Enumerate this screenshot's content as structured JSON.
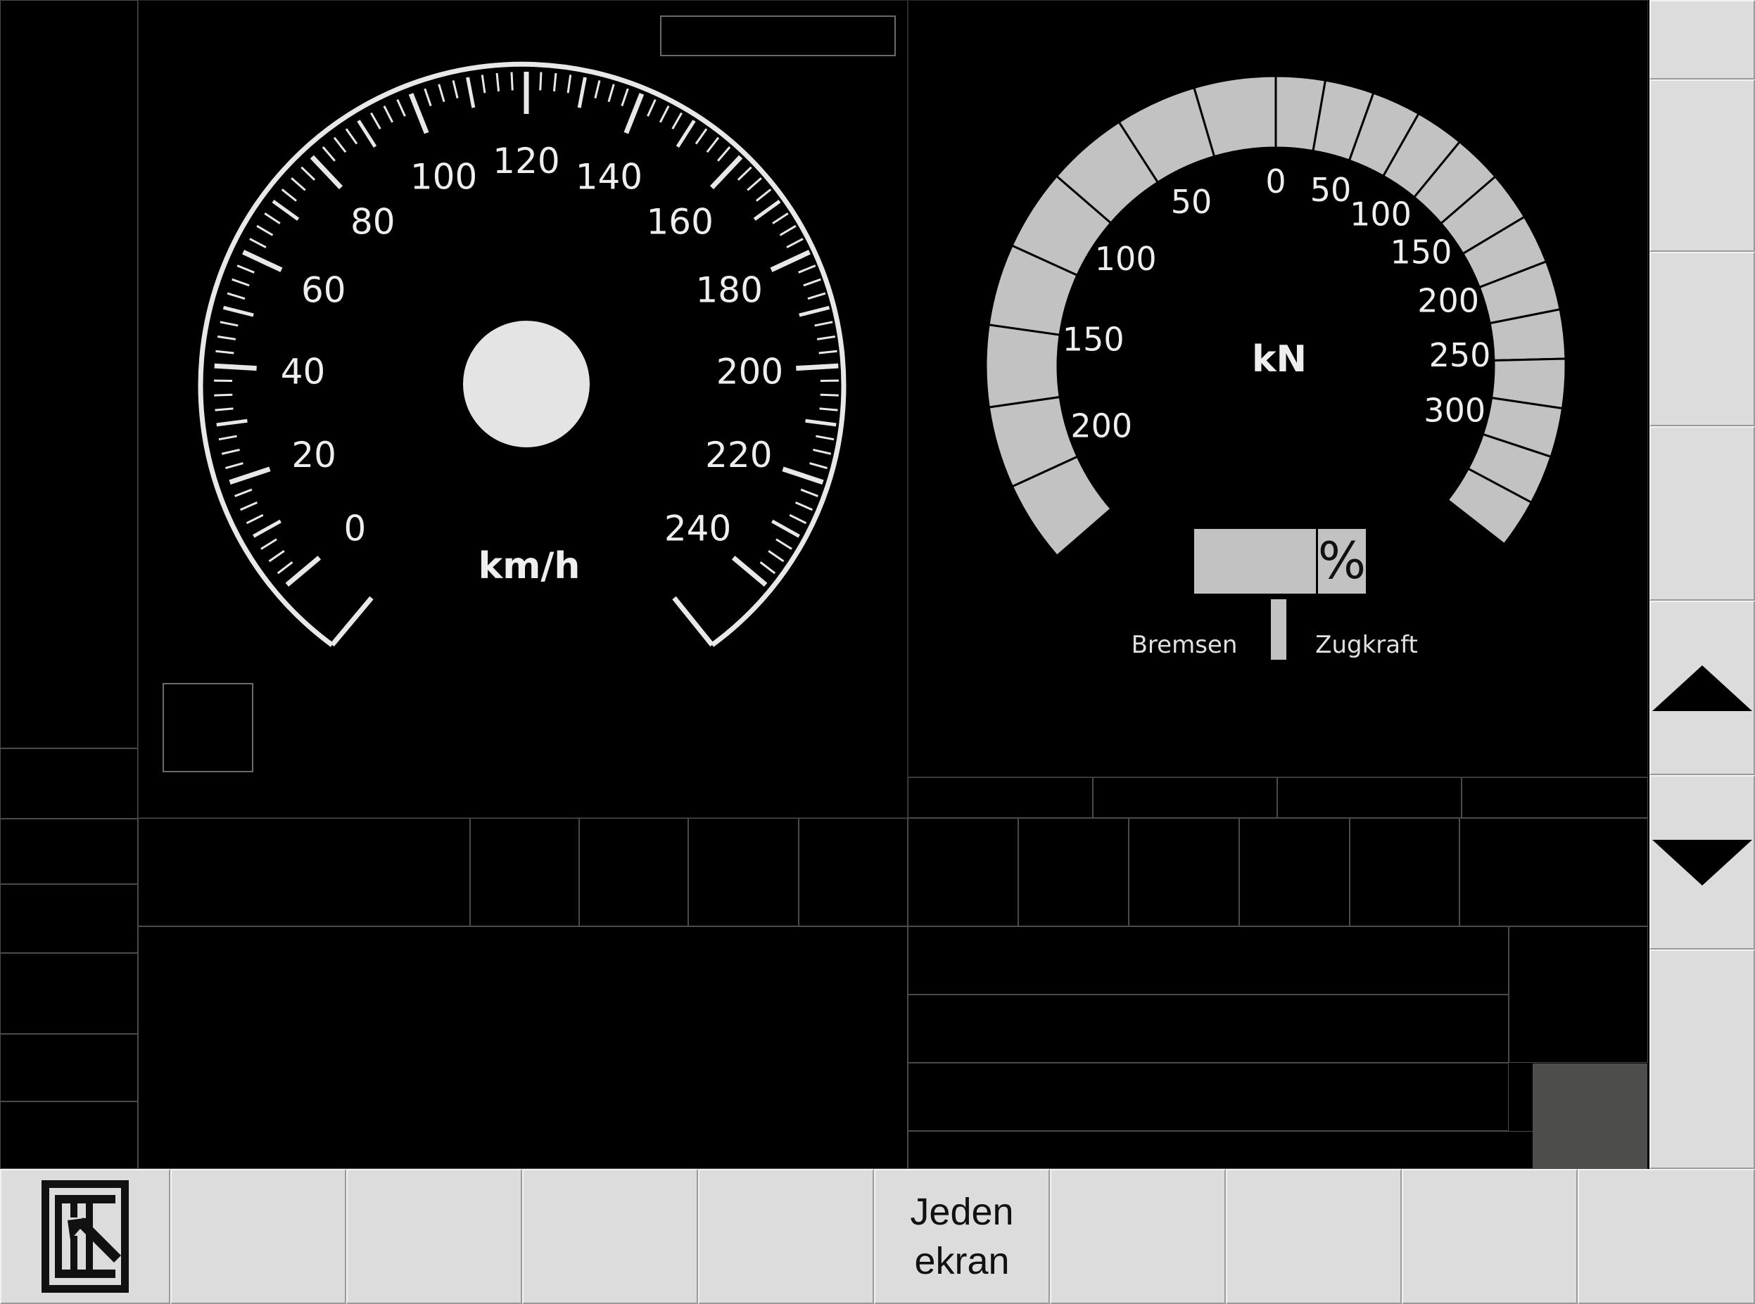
{
  "speedometer": {
    "unit": "km/h",
    "scale_labels": [
      "0",
      "20",
      "40",
      "60",
      "80",
      "100",
      "120",
      "140",
      "160",
      "180",
      "200",
      "220",
      "240"
    ]
  },
  "force_gauge": {
    "unit": "kN",
    "brake_labels": [
      "0",
      "50",
      "100",
      "150",
      "200"
    ],
    "traction_labels": [
      "50",
      "100",
      "150",
      "200",
      "250",
      "300"
    ],
    "percent_symbol": "%",
    "brake_caption": "Bremsen",
    "traction_caption": "Zugkraft"
  },
  "side_buttons": {
    "scroll_up": "up-arrow-icon",
    "scroll_down": "down-arrow-icon"
  },
  "bottom_bar": {
    "exit_icon": "exit-icon",
    "center_button_line1": "Jeden",
    "center_button_line2": "ekran"
  },
  "colors": {
    "background": "#000000",
    "gauge_segment": "#c2c2c2",
    "button_face": "#dcdcdc",
    "indicator_box": "#4d4d4b"
  }
}
